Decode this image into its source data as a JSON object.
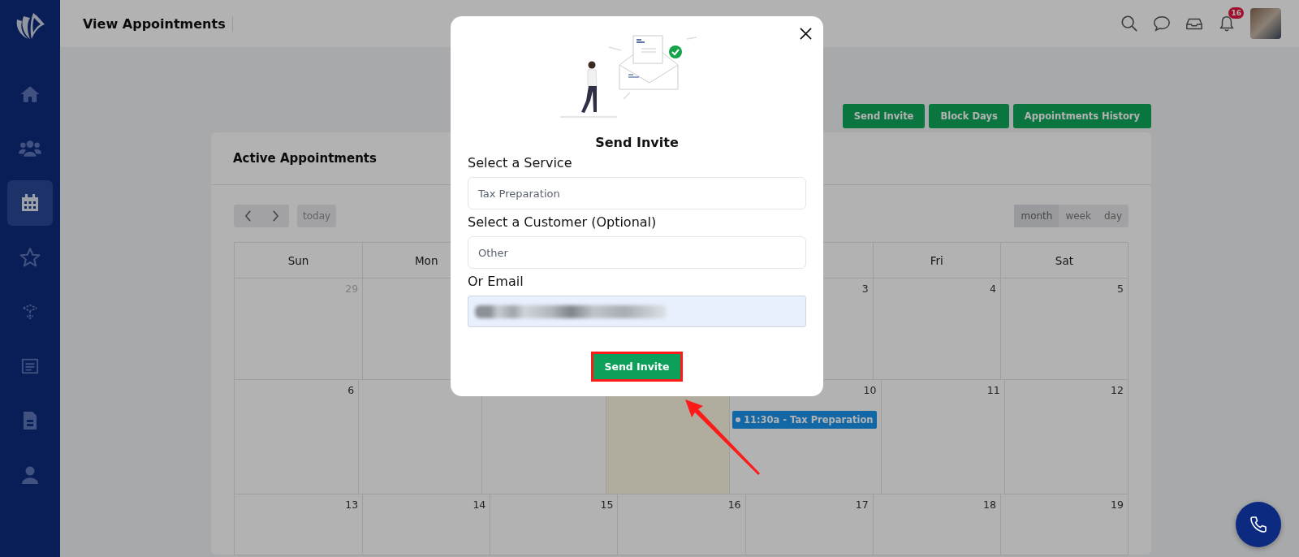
{
  "sidebar": {
    "items": [
      {
        "kind": "home",
        "selected": false
      },
      {
        "kind": "users",
        "selected": false
      },
      {
        "kind": "calendar",
        "selected": true
      },
      {
        "kind": "star",
        "selected": false
      },
      {
        "kind": "box",
        "selected": false
      },
      {
        "kind": "board",
        "selected": false
      },
      {
        "kind": "document",
        "selected": false
      },
      {
        "kind": "user",
        "selected": false
      }
    ]
  },
  "header": {
    "title": "View Appointments",
    "icons": [
      {
        "kind": "search"
      },
      {
        "kind": "chat"
      },
      {
        "kind": "inbox"
      },
      {
        "kind": "bell",
        "badge": "16"
      }
    ]
  },
  "actions": [
    "Send Invite",
    "Block Days",
    "Appointments History"
  ],
  "card": {
    "title": "Active Appointments",
    "today_button": {
      "label": "today",
      "disabled": true
    },
    "views": [
      {
        "label": "month",
        "selected": true
      },
      {
        "label": "week",
        "selected": false
      },
      {
        "label": "day",
        "selected": false
      }
    ],
    "day_headers": [
      {
        "kind": "sun",
        "label": "Sun"
      },
      {
        "kind": "mon",
        "label": "Mon"
      },
      {
        "kind": "fri",
        "label": "Fri"
      },
      {
        "kind": "sat",
        "label": "Sat"
      }
    ],
    "weeks": [
      [
        {
          "kind": "sun",
          "day": "29",
          "muted": true,
          "today": false
        },
        {
          "kind": "mon",
          "today": false
        },
        {
          "kind": "thu",
          "day": "3",
          "muted": false,
          "today": false
        },
        {
          "kind": "fri",
          "day": "4",
          "muted": false,
          "today": false
        },
        {
          "kind": "sat",
          "day": "5",
          "muted": false,
          "today": false
        }
      ],
      [
        {
          "kind": "sun",
          "day": "6",
          "muted": false,
          "today": false
        },
        {
          "kind": "mon",
          "today": false
        },
        {
          "kind": "tue",
          "today": false
        },
        {
          "kind": "wed",
          "today": true
        },
        {
          "kind": "thu",
          "day": "10",
          "muted": false,
          "today": false,
          "events": [
            {
              "label": "11:30a - Tax Preparation"
            }
          ]
        },
        {
          "kind": "fri",
          "day": "11",
          "muted": false,
          "today": false
        },
        {
          "kind": "sat",
          "day": "12",
          "muted": false,
          "today": false
        }
      ],
      [
        {
          "kind": "sun",
          "day": "13",
          "muted": false,
          "today": false
        },
        {
          "kind": "mon",
          "day": "14",
          "muted": false,
          "today": false
        },
        {
          "kind": "tue",
          "day": "15",
          "muted": false,
          "today": false
        },
        {
          "kind": "wed",
          "day": "16",
          "muted": false,
          "today": false
        },
        {
          "kind": "thu",
          "day": "17",
          "muted": false,
          "today": false
        },
        {
          "kind": "fri",
          "day": "18",
          "muted": false,
          "today": false
        },
        {
          "kind": "sat",
          "day": "19",
          "muted": false,
          "today": false
        }
      ]
    ]
  },
  "modal": {
    "title": "Send Invite",
    "fields": [
      {
        "kind": "select",
        "label": "Select a Service",
        "value": "Tax Preparation"
      },
      {
        "kind": "select",
        "label": "Select a Customer (Optional)",
        "value": "Other"
      },
      {
        "kind": "redacted",
        "label": "Or Email"
      }
    ],
    "submit": "Send Invite"
  }
}
